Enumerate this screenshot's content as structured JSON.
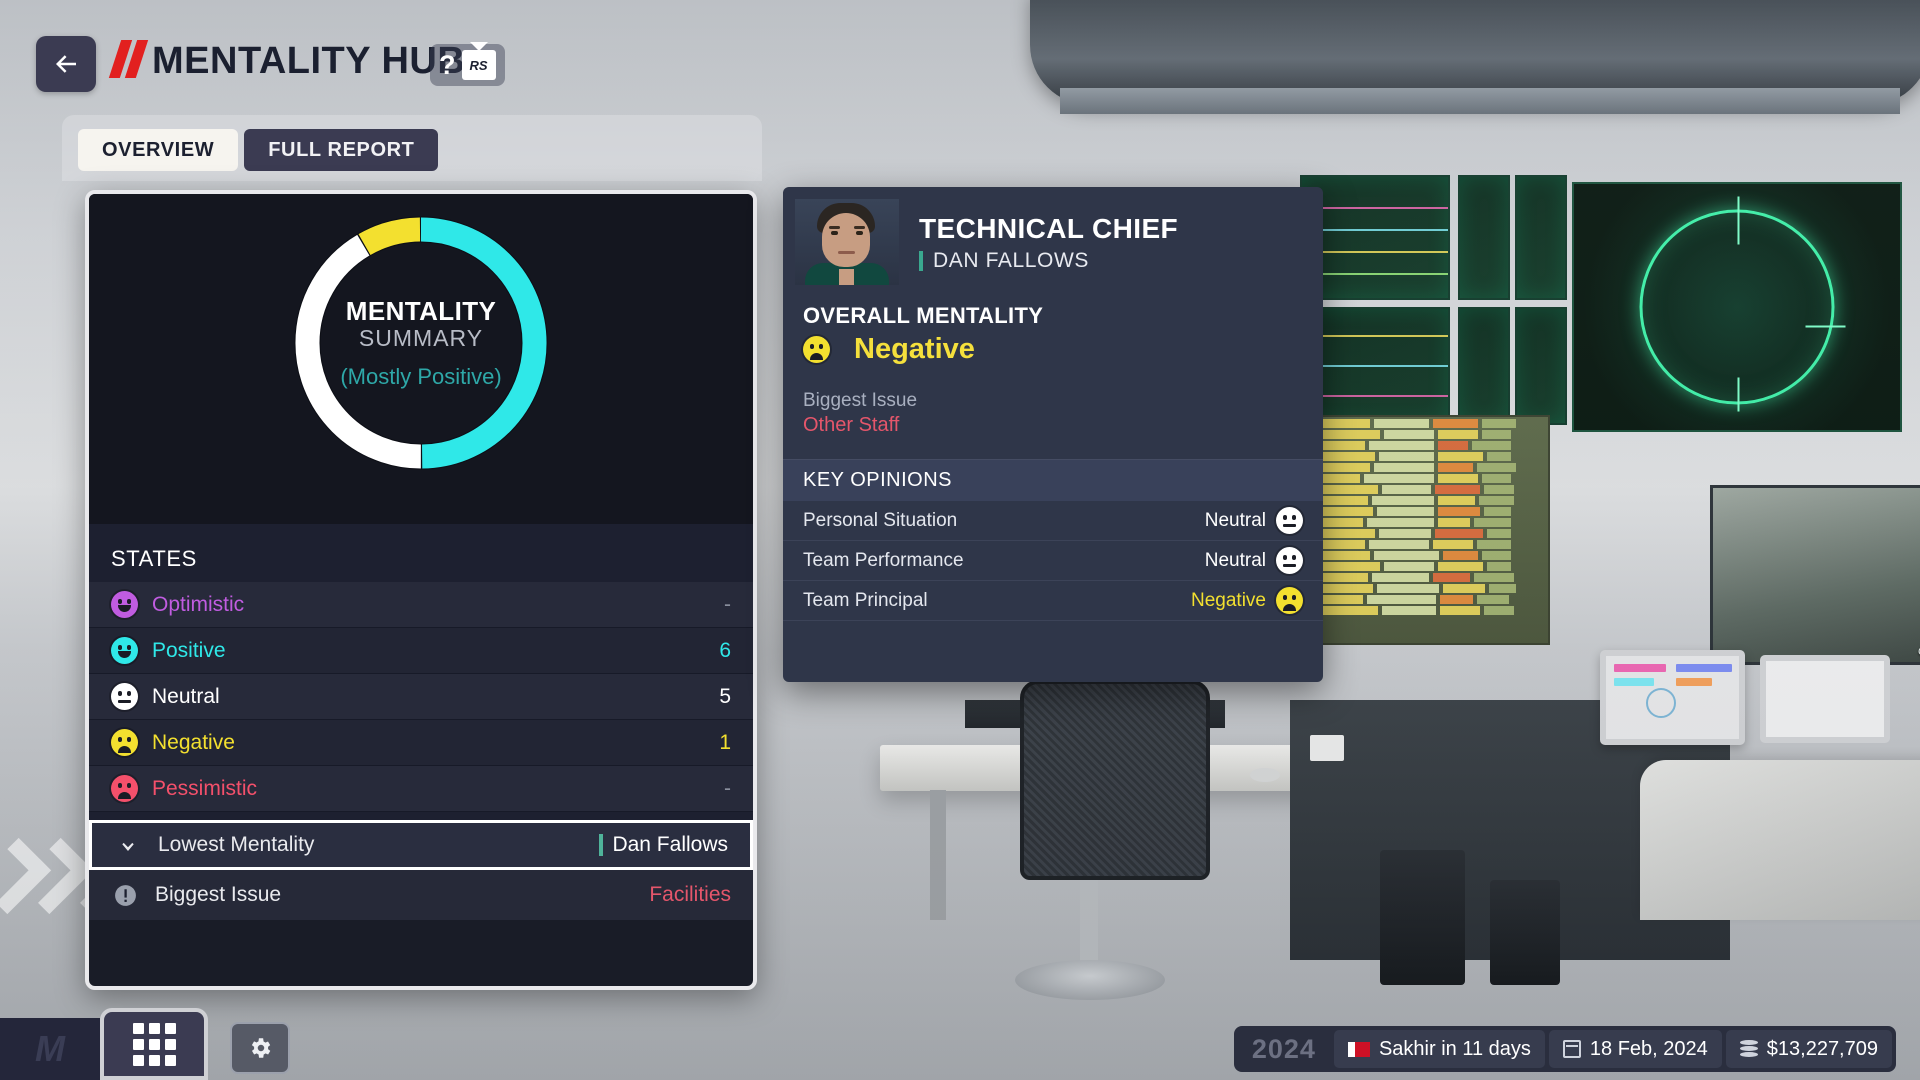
{
  "header": {
    "back_icon": "arrow-left-icon",
    "title": "MENTALITY HUB",
    "help_label": "?",
    "rs_badge": "RS"
  },
  "tabs": [
    {
      "label": "OVERVIEW",
      "active": true
    },
    {
      "label": "FULL REPORT",
      "active": false
    }
  ],
  "overview": {
    "donut": {
      "line1": "MENTALITY",
      "line2": "SUMMARY",
      "line3": "(Mostly Positive)"
    },
    "states_heading": "STATES",
    "states": [
      {
        "label": "Optimistic",
        "value": "-",
        "color": "#c05ce0",
        "face": "smile"
      },
      {
        "label": "Positive",
        "value": "6",
        "color": "#2fe8e8",
        "face": "smile"
      },
      {
        "label": "Neutral",
        "value": "5",
        "color": "#ffffff",
        "face": "flat"
      },
      {
        "label": "Negative",
        "value": "1",
        "color": "#f3e02f",
        "face": "frown"
      },
      {
        "label": "Pessimistic",
        "value": "-",
        "color": "#f4506b",
        "face": "frown"
      }
    ],
    "lowest_mentality": {
      "icon": "arrow-down-icon",
      "label": "Lowest Mentality",
      "value": "Dan Fallows",
      "selected": true
    },
    "biggest_issue": {
      "icon": "exclamation-circle-icon",
      "label": "Biggest Issue",
      "value": "Facilities",
      "value_color": "#e5566b"
    }
  },
  "detail": {
    "role": "TECHNICAL CHIEF",
    "name": "DAN FALLOWS",
    "overall_mentality_label": "OVERALL MENTALITY",
    "overall_mentality_value": "Negative",
    "overall_mentality_color": "#f5e03c",
    "biggest_issue_label": "Biggest Issue",
    "biggest_issue_value": "Other Staff",
    "key_opinions_heading": "KEY OPINIONS",
    "key_opinions": [
      {
        "label": "Personal Situation",
        "value": "Neutral",
        "color": "#ffffff",
        "face": "flat"
      },
      {
        "label": "Team Performance",
        "value": "Neutral",
        "color": "#ffffff",
        "face": "flat"
      },
      {
        "label": "Team Principal",
        "value": "Negative",
        "color": "#f3e02f",
        "face": "frown"
      }
    ]
  },
  "taskbar": {
    "logo": "M",
    "apps_icon": "grid-apps-icon",
    "settings_icon": "gear-icon"
  },
  "statusbar": {
    "season": "2024",
    "next_race": "Sakhir in 11 days",
    "date": "18 Feb, 2024",
    "balance": "$13,227,709"
  },
  "chart_data": {
    "type": "pie",
    "title": "MENTALITY SUMMARY",
    "subtitle": "(Mostly Positive)",
    "categories": [
      "Positive",
      "Neutral",
      "Negative"
    ],
    "values": [
      6,
      5,
      1
    ],
    "colors": [
      "#2fe8e8",
      "#ffffff",
      "#f3e02f"
    ],
    "total": 12,
    "legend": "states-list",
    "grid": false
  }
}
